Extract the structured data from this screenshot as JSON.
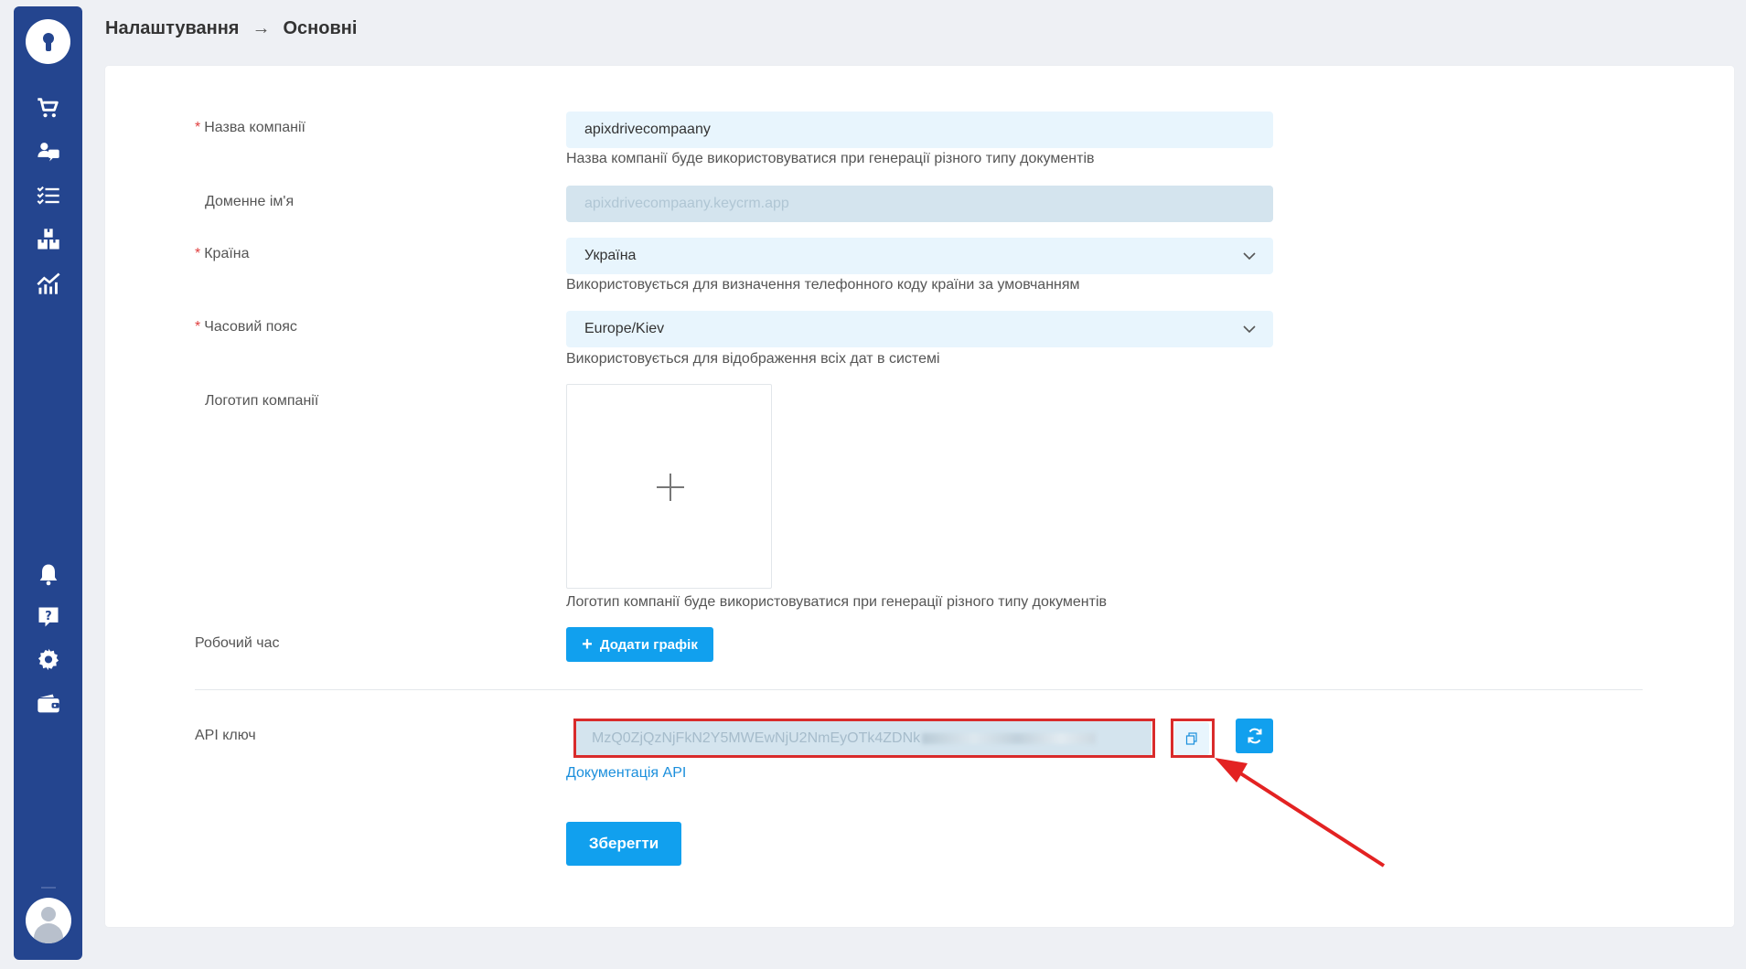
{
  "breadcrumb": {
    "parent": "Налаштування",
    "separator": "→",
    "current": "Основні"
  },
  "sidebar": {
    "items": [
      {
        "icon": "cart-icon"
      },
      {
        "icon": "contacts-icon"
      },
      {
        "icon": "tasks-icon"
      },
      {
        "icon": "warehouse-icon"
      },
      {
        "icon": "analytics-icon"
      }
    ],
    "bottom_items": [
      {
        "icon": "bell-icon"
      },
      {
        "icon": "help-icon"
      },
      {
        "icon": "gear-icon"
      },
      {
        "icon": "wallet-icon"
      }
    ]
  },
  "form": {
    "company_name": {
      "label": "Назва компанії",
      "value": "apixdrivecompaany",
      "hint": "Назва компанії буде використовуватися при генерації різного типу документів"
    },
    "domain": {
      "label": "Доменне ім'я",
      "value": "apixdrivecompaany.keycrm.app"
    },
    "country": {
      "label": "Країна",
      "value": "Україна",
      "hint": "Використовується для визначення телефонного коду країни за умовчанням"
    },
    "timezone": {
      "label": "Часовий пояс",
      "value": "Europe/Kiev",
      "hint": "Використовується для відображення всіх дат в системі"
    },
    "logo": {
      "label": "Логотип компанії",
      "hint": "Логотип компанії буде використовуватися при генерації різного типу документів"
    },
    "working_hours": {
      "label": "Робочий час",
      "button": "Додати графік"
    },
    "api_key": {
      "label": "API ключ",
      "value": "MzQ0ZjQzNjFkN2Y5MWEwNjU2NmEyOTk4ZDNk",
      "doc_link": "Документація API"
    },
    "save_button": "Зберегти"
  },
  "colors": {
    "sidebar": "#24458f",
    "primary": "#11a0ee",
    "input_bg": "#e8f5fd",
    "annotation_red": "#d92b2b"
  }
}
